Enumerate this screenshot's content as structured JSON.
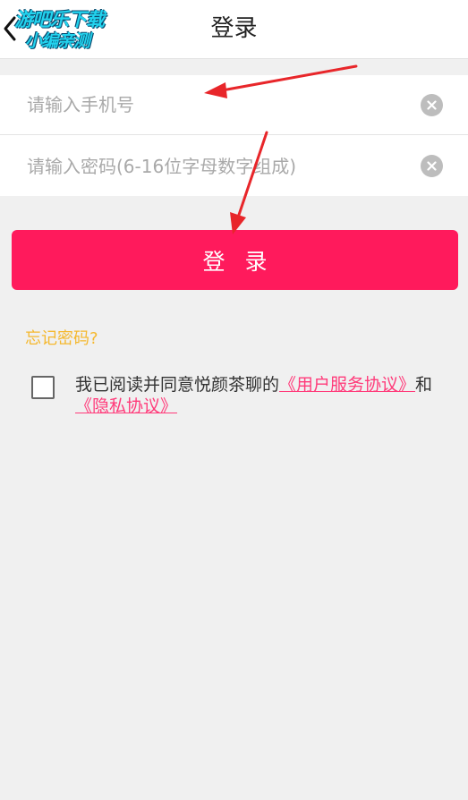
{
  "header": {
    "title": "登录",
    "back_icon": "chevron-left-icon"
  },
  "watermark": {
    "line1": "游吧乐下载",
    "line2": "小编亲测"
  },
  "form": {
    "phone_placeholder": "请输入手机号",
    "phone_value": "",
    "password_placeholder": "请输入密码(6-16位字母数字组成)",
    "password_value": "",
    "clear_icon": "clear-circle-icon"
  },
  "login_button": {
    "label": "登录"
  },
  "forgot_password": "忘记密码?",
  "agreement": {
    "checked": false,
    "prefix": "我已阅读并同意悦颜茶聊的",
    "user_agreement": "《用户服务协议》",
    "connector": "和",
    "privacy_policy": "《隐私协议》"
  },
  "colors": {
    "accent": "#ff1a5c",
    "link": "#ff3b7a",
    "forgot": "#f5b82e",
    "annotation_arrow": "#e8262a",
    "background": "#f0f0f0"
  }
}
